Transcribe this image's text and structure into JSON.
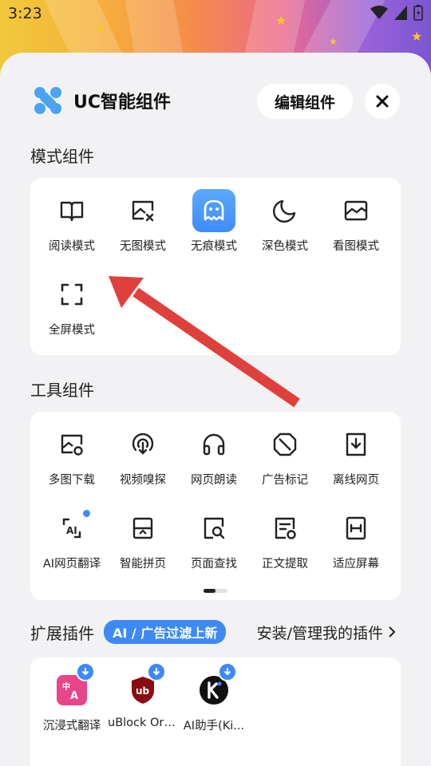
{
  "status": {
    "time": "3:23"
  },
  "header": {
    "title": "UC智能组件",
    "edit_label": "编辑组件"
  },
  "mode_section": {
    "title": "模式组件",
    "items": [
      {
        "label": "阅读模式",
        "icon": "book-icon"
      },
      {
        "label": "无图模式",
        "icon": "no-image-icon"
      },
      {
        "label": "无痕模式",
        "icon": "ghost-icon"
      },
      {
        "label": "深色模式",
        "icon": "moon-icon"
      },
      {
        "label": "看图模式",
        "icon": "image-icon"
      },
      {
        "label": "全屏模式",
        "icon": "fullscreen-icon"
      }
    ]
  },
  "tool_section": {
    "title": "工具组件",
    "items": [
      {
        "label": "多图下载",
        "icon": "multi-image-download-icon"
      },
      {
        "label": "视频嗅探",
        "icon": "video-sniff-icon"
      },
      {
        "label": "网页朗读",
        "icon": "headphones-icon"
      },
      {
        "label": "广告标记",
        "icon": "ad-block-icon"
      },
      {
        "label": "离线网页",
        "icon": "offline-page-icon"
      },
      {
        "label": "AI网页翻译",
        "icon": "ai-translate-icon"
      },
      {
        "label": "智能拼页",
        "icon": "page-merge-icon"
      },
      {
        "label": "页面查找",
        "icon": "page-search-icon"
      },
      {
        "label": "正文提取",
        "icon": "text-extract-icon"
      },
      {
        "label": "适应屏幕",
        "icon": "fit-screen-icon"
      }
    ]
  },
  "ext_section": {
    "title": "扩展插件",
    "tag": "AI / 广告过滤上新",
    "manage": "安装/管理我的插件",
    "plugins": [
      {
        "label": "沉浸式翻译",
        "icon": "immersive-translate-icon",
        "color": "#e8458a"
      },
      {
        "label": "uBlock Ori...",
        "icon": "ublock-origin-icon",
        "color": "#8a0c12"
      },
      {
        "label": "AI助手(Ki...",
        "icon": "kimi-icon",
        "color": "#111111"
      }
    ]
  },
  "colors": {
    "accent": "#3d8af7",
    "arrow": "#e0403c"
  }
}
